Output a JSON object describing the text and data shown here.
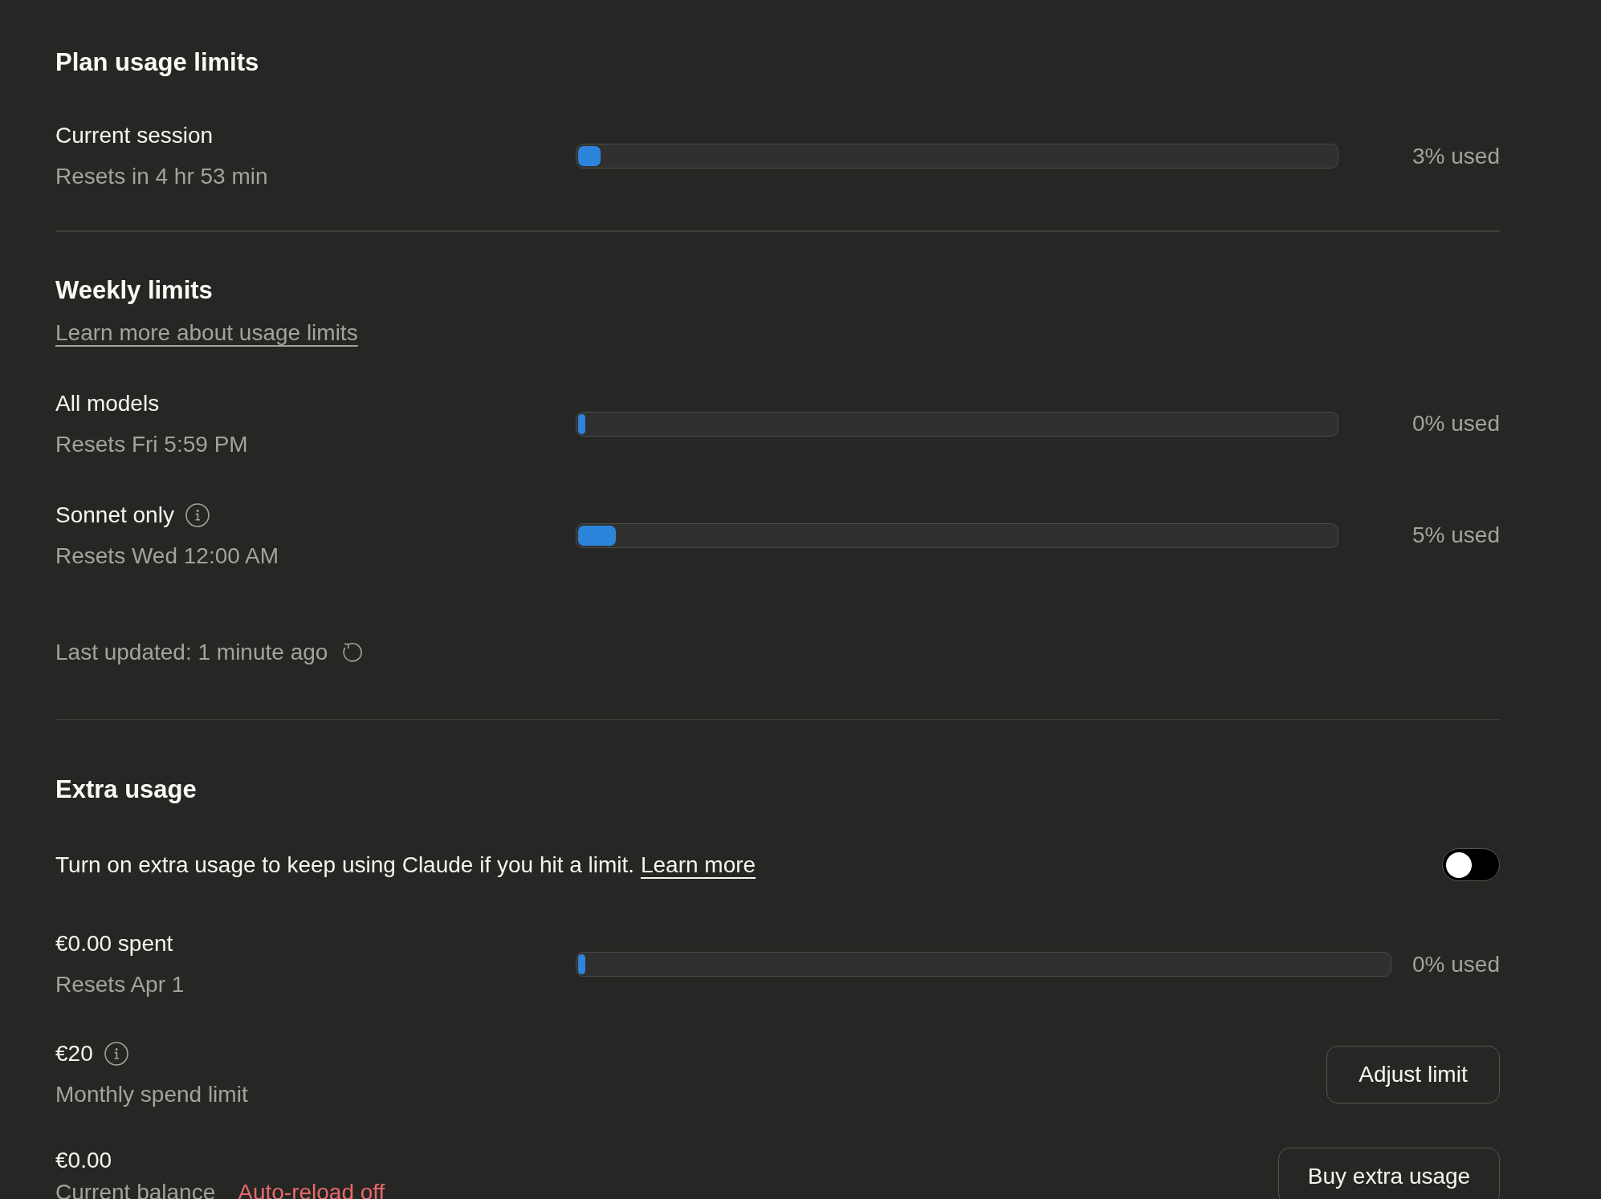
{
  "plan_usage": {
    "title": "Plan usage limits",
    "items": [
      {
        "label": "Current session",
        "info": false,
        "sublabel": "Resets in 4 hr 53 min",
        "level": 0.03,
        "reading": "3% used"
      }
    ]
  },
  "weekly_limits": {
    "title": "Weekly limits",
    "link": "Learn more about usage limits",
    "items": [
      {
        "label": "All models",
        "info": false,
        "sublabel": "Resets Fri 5:59 PM",
        "level": 0,
        "reading": "0% used"
      },
      {
        "label": "Sonnet only",
        "info": true,
        "sublabel": "Resets Wed 12:00 AM",
        "level": 0.05,
        "reading": "5% used"
      }
    ],
    "last_updated": "Last updated: 1 minute ago"
  },
  "extra_usage": {
    "title": "Extra usage",
    "description": "Turn on extra usage to keep using Claude if you hit a limit.",
    "link": "Learn more",
    "toggle": {
      "on": false
    },
    "spent": {
      "label": "€0.00 spent",
      "sublabel": "Resets Apr 1",
      "level": 0,
      "reading": "0% used"
    },
    "limit": {
      "amount": "€20",
      "info": true,
      "sublabel": "Monthly spend limit",
      "button": "Adjust limit"
    },
    "balance": {
      "amount": "€0.00",
      "sublabel": "Current balance",
      "status": "Auto-reload off",
      "button": "Buy extra usage"
    }
  }
}
